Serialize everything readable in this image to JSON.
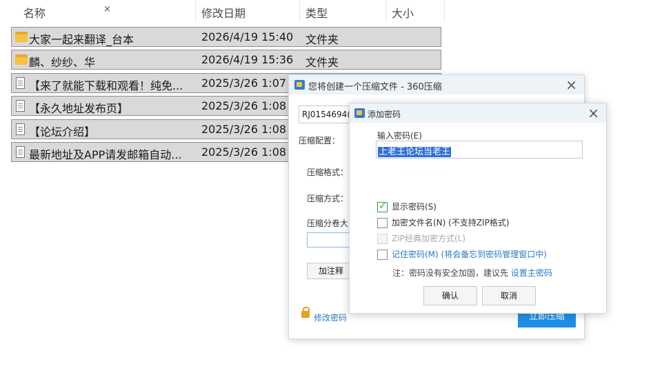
{
  "explorer": {
    "columns": {
      "name": "名称",
      "modified": "修改日期",
      "type": "类型",
      "size": "大小"
    },
    "close_glyph": "×",
    "files": [
      {
        "name": "大家一起来翻译_台本",
        "date": "2026/4/19 15:40",
        "type": "文件夹",
        "icon": "folder-icon"
      },
      {
        "name": "麟、纱纱、华",
        "date": "2026/4/19 15:36",
        "type": "文件夹",
        "icon": "folder-icon"
      },
      {
        "name": "【来了就能下载和观看！纯免...",
        "date": "2025/3/26 1:07",
        "type": "",
        "icon": "document-icon"
      },
      {
        "name": "【永久地址发布页】",
        "date": "2025/3/26 1:08",
        "type": "",
        "icon": "document-icon"
      },
      {
        "name": "【论坛介绍】",
        "date": "2025/3/26 1:08",
        "type": "",
        "icon": "document-icon"
      },
      {
        "name": "最新地址及APP请发邮箱自动...",
        "date": "2025/3/26 1:08",
        "type": "",
        "icon": "document-icon"
      }
    ]
  },
  "compress_dialog": {
    "title": "您将创建一个压缩文件 - 360压缩",
    "filename": "RJ0154694(",
    "compress_config_label": "压缩配置：",
    "format_label": "压缩格式：",
    "method_label": "压缩方式：",
    "split_label": "压缩分卷大",
    "comment_button": "加注释",
    "modify_password": "修改密码",
    "start_button": "立即压缩"
  },
  "password_dialog": {
    "title": "添加密码",
    "input_label": "输入密码(E)",
    "password_value": "上老王论坛当老王",
    "options": {
      "show_password": "显示密码(S)",
      "encrypt_filenames": "加密文件名(N) (不支持ZIP格式)",
      "zip_classic": "ZIP经典加密方式(L)",
      "remember_password": "记住密码(M) (将会备忘到密码管理窗口中)"
    },
    "note_text": "注：密码没有安全加固，建议先",
    "note_link": "设置主密码",
    "ok_button": "确认",
    "cancel_button": "取消"
  }
}
